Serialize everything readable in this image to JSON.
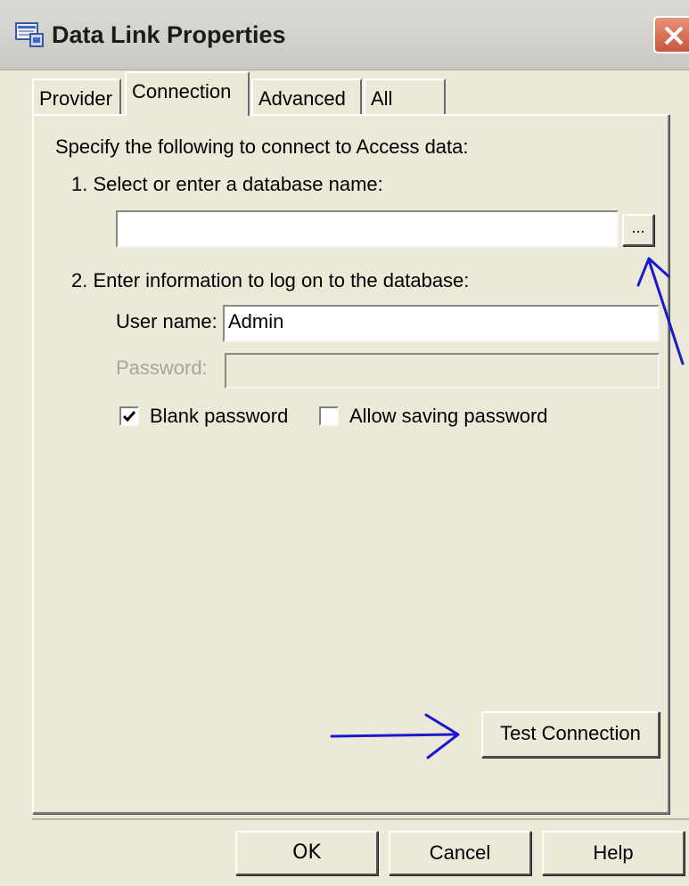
{
  "window": {
    "title": "Data Link Properties",
    "title_icon": "data-link-icon",
    "close_icon": "close-icon"
  },
  "tabs": [
    {
      "label": "Provider",
      "active": false
    },
    {
      "label": "Connection",
      "active": true
    },
    {
      "label": "Advanced",
      "active": false
    },
    {
      "label": "All",
      "active": false
    }
  ],
  "connection": {
    "intro": "Specify the following to connect to Access data:",
    "step1_label": "1. Select or enter a database name:",
    "database_name_value": "",
    "browse_label": "...",
    "step2_label": "2. Enter information to log on to the database:",
    "username_label": "User name:",
    "username_value": "Admin",
    "password_label": "Password:",
    "password_value": "",
    "blank_password_label": "Blank password",
    "blank_password_checked": true,
    "allow_saving_label": "Allow saving password",
    "allow_saving_checked": false,
    "test_connection_label": "Test Connection"
  },
  "footer": {
    "ok_label": "OK",
    "cancel_label": "Cancel",
    "help_label": "Help"
  },
  "annotations": {
    "arrow_color": "#1a1acc"
  }
}
